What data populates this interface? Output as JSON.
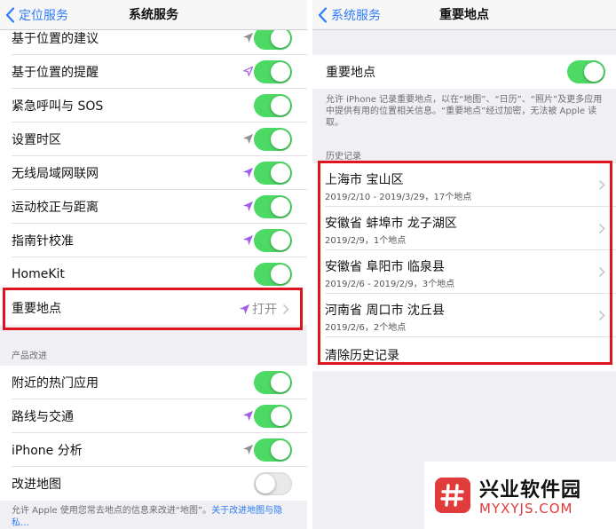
{
  "left_screen": {
    "nav": {
      "back_label": "定位服务",
      "title": "系统服务"
    },
    "rows": [
      {
        "label": "基于位置的建议",
        "arrow": "gray",
        "toggle": "on"
      },
      {
        "label": "基于位置的提醒",
        "arrow": "outline-purple",
        "toggle": "on"
      },
      {
        "label": "紧急呼叫与 SOS",
        "arrow": "none",
        "toggle": "on"
      },
      {
        "label": "设置时区",
        "arrow": "gray",
        "toggle": "on"
      },
      {
        "label": "无线局域网联网",
        "arrow": "purple",
        "toggle": "on"
      },
      {
        "label": "运动校正与距离",
        "arrow": "purple",
        "toggle": "on"
      },
      {
        "label": "指南针校准",
        "arrow": "purple",
        "toggle": "on"
      },
      {
        "label": "HomeKit",
        "arrow": "none",
        "toggle": "on"
      }
    ],
    "significant_row": {
      "label": "重要地点",
      "arrow": "purple",
      "value": "打开"
    },
    "section_header": "产品改进",
    "product_rows": [
      {
        "label": "附近的热门应用",
        "arrow": "none",
        "toggle": "on"
      },
      {
        "label": "路线与交通",
        "arrow": "purple",
        "toggle": "on"
      },
      {
        "label": "iPhone 分析",
        "arrow": "gray",
        "toggle": "on"
      },
      {
        "label": "改进地图",
        "arrow": "none",
        "toggle": "off"
      }
    ],
    "footer": {
      "text": "允许 Apple 使用您常去地点的信息来改进“地图”。",
      "link": "关于改进地图与隐私…"
    }
  },
  "right_screen": {
    "nav": {
      "back_label": "系统服务",
      "title": "重要地点"
    },
    "toggle_row": {
      "label": "重要地点",
      "toggle": "on"
    },
    "description": "允许 iPhone 记录重要地点，以在“地图”、“日历”、“照片”及更多应用中提供有用的位置相关信息。“重要地点”经过加密，无法被 Apple 读取。",
    "history_header": "历史记录",
    "history": [
      {
        "title": "上海市 宝山区",
        "subtitle": "2019/2/10 - 2019/3/29，17个地点"
      },
      {
        "title": "安徽省 蚌埠市 龙子湖区",
        "subtitle": "2019/2/9，1个地点"
      },
      {
        "title": "安徽省 阜阳市 临泉县",
        "subtitle": "2019/2/6 - 2019/2/9，3个地点"
      },
      {
        "title": "河南省 周口市 沈丘县",
        "subtitle": "2019/2/6，2个地点"
      }
    ],
    "clear_label": "清除历史记录"
  },
  "watermark": {
    "name": "兴业软件园",
    "url": "MYXYJS.COM"
  },
  "colors": {
    "toggle_on": "#4cd964",
    "ios_blue": "#2e7cf6",
    "highlight_red": "#e0141e",
    "arrow_purple": "#a25ee8",
    "arrow_gray": "#8e8e93",
    "watermark_red": "#e23b3b"
  },
  "icons": {
    "back": "chevron-left-icon",
    "location": "location-arrow-icon",
    "disclosure": "chevron-right-icon",
    "watermark": "hash-logo-icon"
  }
}
